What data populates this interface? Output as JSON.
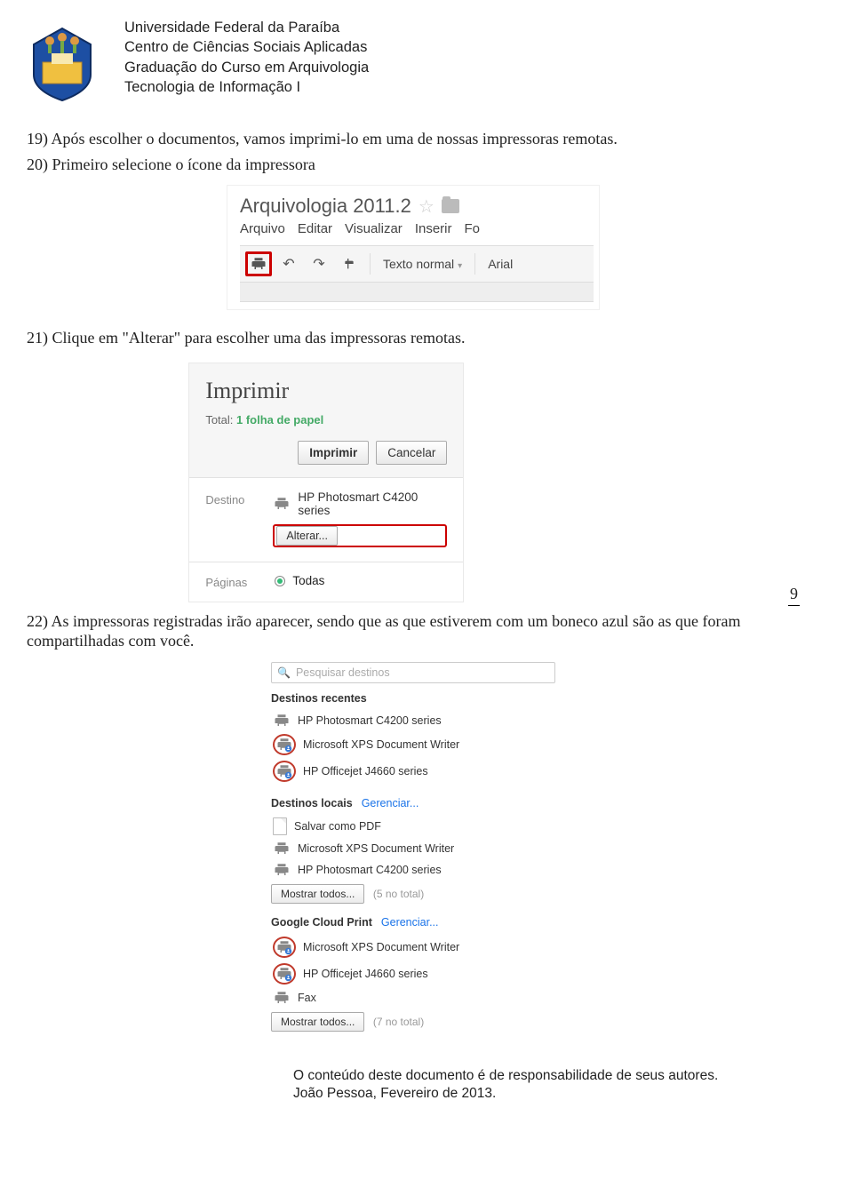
{
  "header": {
    "line1": "Universidade Federal da Paraíba",
    "line2": "Centro de Ciências Sociais Aplicadas",
    "line3": "Graduação do Curso em Arquivologia",
    "line4": "Tecnologia de Informação I"
  },
  "body": {
    "step19": "19) Após escolher o documentos, vamos imprimi-lo em uma de nossas impressoras remotas.",
    "step20": "20) Primeiro selecione o ícone da impressora",
    "step21": "21) Clique em \"Alterar\" para escolher uma das impressoras remotas.",
    "step22": "22) As impressoras registradas irão aparecer, sendo que as que estiverem com um boneco azul são as que foram compartilhadas com você."
  },
  "page_number": "9",
  "fig1": {
    "doc_title": "Arquivologia 2011.2",
    "menus": [
      "Arquivo",
      "Editar",
      "Visualizar",
      "Inserir",
      "Fo"
    ],
    "style_select": "Texto normal",
    "font_select": "Arial"
  },
  "fig2": {
    "title": "Imprimir",
    "total_prefix": "Total: ",
    "total_bold": "1 folha de papel",
    "btn_print": "Imprimir",
    "btn_cancel": "Cancelar",
    "label_dest": "Destino",
    "dest_name": "HP Photosmart C4200 series",
    "btn_change": "Alterar...",
    "label_pages": "Páginas",
    "radio_all": "Todas"
  },
  "fig3": {
    "search_placeholder": "Pesquisar destinos",
    "sec_recent": "Destinos recentes",
    "recent": [
      "HP Photosmart C4200 series",
      "Microsoft XPS Document Writer",
      "HP Officejet J4660 series"
    ],
    "sec_local": "Destinos locais",
    "manage": "Gerenciar...",
    "local_pdf": "Salvar como PDF",
    "local": [
      "Microsoft XPS Document Writer",
      "HP Photosmart C4200 series"
    ],
    "show_all": "Mostrar todos...",
    "local_count": "(5 no total)",
    "sec_gcp": "Google Cloud Print",
    "gcp": [
      "Microsoft XPS Document Writer",
      "HP Officejet J4660 series",
      "Fax"
    ],
    "gcp_count": "(7 no total)"
  },
  "footer": {
    "line1": "O conteúdo deste documento é de responsabilidade de seus autores.",
    "line2": "João Pessoa, Fevereiro de 2013."
  }
}
